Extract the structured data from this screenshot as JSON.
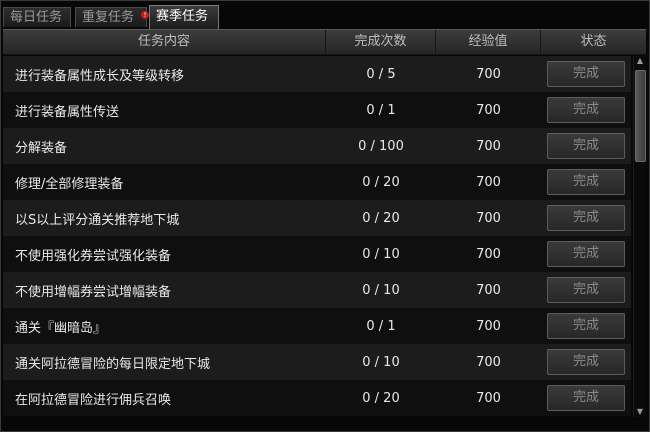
{
  "tabs": [
    {
      "label": "每日任务",
      "active": false
    },
    {
      "label": "重复任务",
      "active": false,
      "badge": "!"
    },
    {
      "label": "赛季任务",
      "active": true
    }
  ],
  "table": {
    "headers": [
      "任务内容",
      "完成次数",
      "经验值",
      "状态"
    ],
    "rows": [
      {
        "name": "进行装备属性成长及等级转移",
        "count": "0 / 5",
        "exp": "700",
        "status": "完成"
      },
      {
        "name": "进行装备属性传送",
        "count": "0 / 1",
        "exp": "700",
        "status": "完成"
      },
      {
        "name": "分解装备",
        "count": "0 / 100",
        "exp": "700",
        "status": "完成"
      },
      {
        "name": "修理/全部修理装备",
        "count": "0 / 20",
        "exp": "700",
        "status": "完成"
      },
      {
        "name": "以S以上评分通关推荐地下城",
        "count": "0 / 20",
        "exp": "700",
        "status": "完成"
      },
      {
        "name": "不使用强化券尝试强化装备",
        "count": "0 / 10",
        "exp": "700",
        "status": "完成"
      },
      {
        "name": "不使用增幅券尝试增幅装备",
        "count": "0 / 10",
        "exp": "700",
        "status": "完成"
      },
      {
        "name": "通关『幽暗岛』",
        "count": "0 / 1",
        "exp": "700",
        "status": "完成"
      },
      {
        "name": "通关阿拉德冒险的每日限定地下城",
        "count": "0 / 10",
        "exp": "700",
        "status": "完成"
      },
      {
        "name": "在阿拉德冒险进行佣兵召唤",
        "count": "0 / 20",
        "exp": "700",
        "status": "完成"
      }
    ]
  },
  "scrollbar": {
    "up_icon": "triangle-up-icon",
    "down_icon": "triangle-down-icon"
  }
}
